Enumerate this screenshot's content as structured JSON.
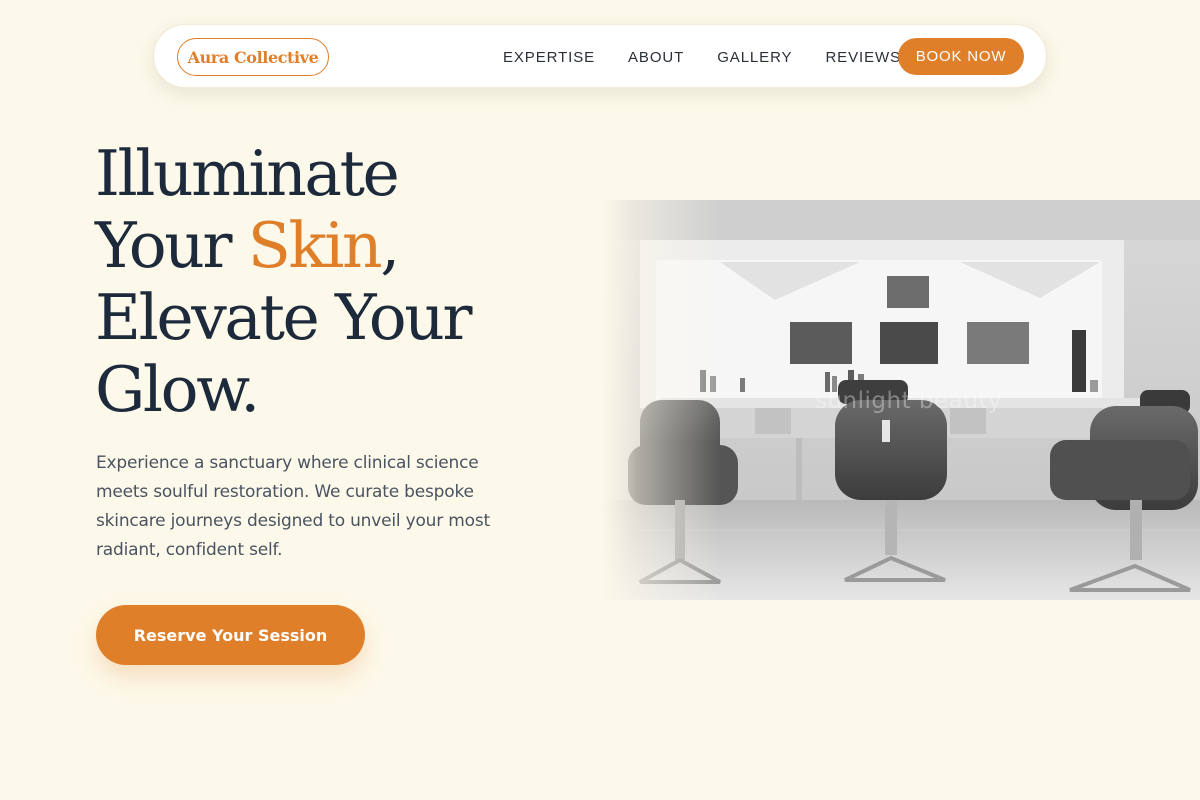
{
  "nav": {
    "brand": "Aura Collective",
    "links": [
      {
        "label": "EXPERTISE"
      },
      {
        "label": "ABOUT"
      },
      {
        "label": "GALLERY"
      },
      {
        "label": "REVIEWS"
      }
    ],
    "cta_label": "BOOK NOW"
  },
  "hero": {
    "headline": {
      "line1": "Illuminate",
      "line2_before": "Your ",
      "line2_accent": "Skin",
      "line2_after": ",",
      "line3": "Elevate Your",
      "line4": "Glow."
    },
    "description": "Experience a sanctuary where clinical science meets soulful restoration. We curate bespoke skincare journeys designed to unveil your most radiant, confident self.",
    "cta_label": "Reserve Your Session",
    "image": {
      "subject": "salon-interior-photo",
      "watermark": "sunlight beauty"
    }
  },
  "colors": {
    "background": "#fdf9ea",
    "accent": "#e07f2a",
    "heading": "#1d2a3b",
    "body_text": "#4a5361"
  }
}
